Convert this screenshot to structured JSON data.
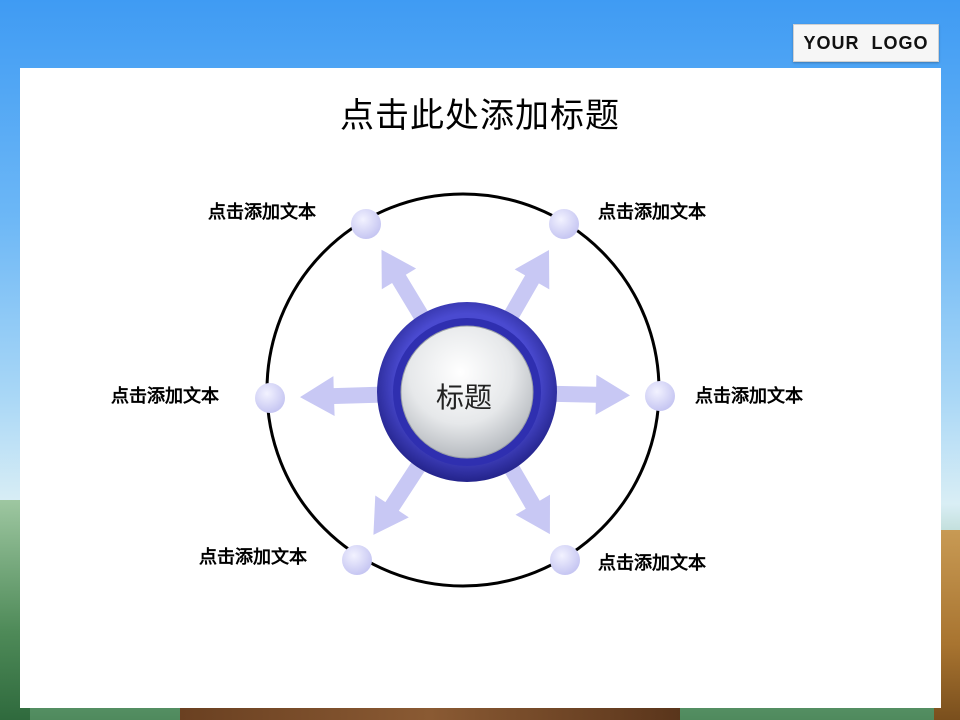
{
  "logo": {
    "text": "YOUR  LOGO"
  },
  "slide": {
    "title": "点击此处添加标题"
  },
  "diagram": {
    "center_label": "标题",
    "nodes": [
      {
        "id": "top-left",
        "label": "点击添加文本"
      },
      {
        "id": "top-right",
        "label": "点击添加文本"
      },
      {
        "id": "left",
        "label": "点击添加文本"
      },
      {
        "id": "right",
        "label": "点击添加文本"
      },
      {
        "id": "bottom-left",
        "label": "点击添加文本"
      },
      {
        "id": "bottom-right",
        "label": "点击添加文本"
      }
    ]
  },
  "colors": {
    "ring_outer": "#2b2b9a",
    "ring_inner": "#3b3bc4",
    "arrow": "#c8c8f4",
    "node": "#d6d6f7",
    "circle_stroke": "#000000"
  }
}
